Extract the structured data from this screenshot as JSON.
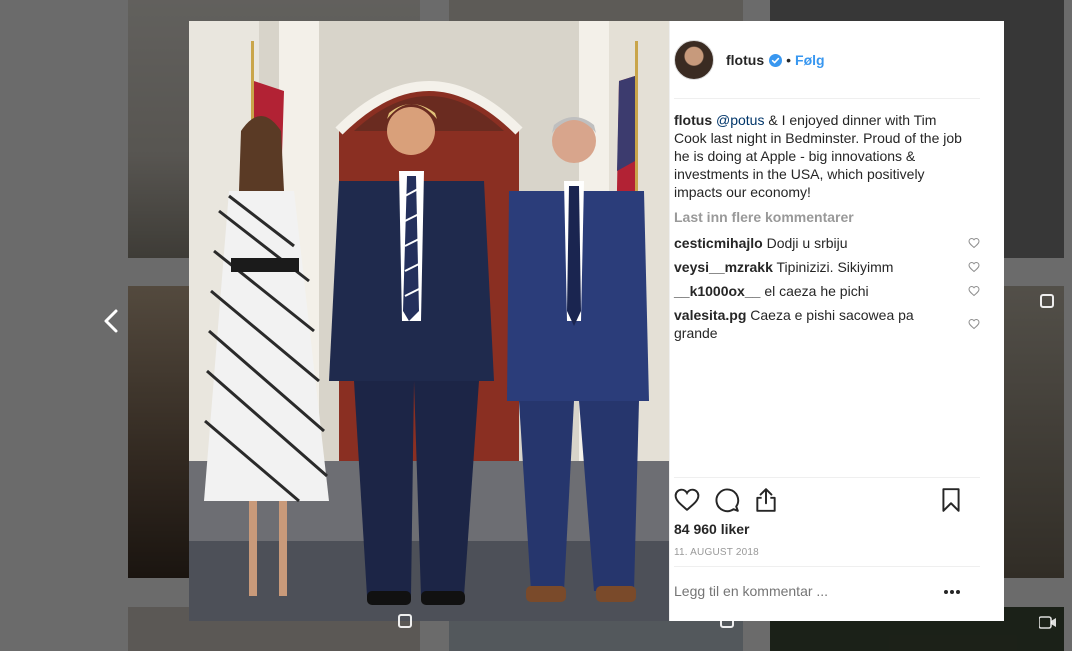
{
  "header": {
    "username": "flotus",
    "separator": "•",
    "follow_label": "Følg"
  },
  "caption": {
    "username": "flotus",
    "mention": "@potus",
    "text": " & I enjoyed dinner with Tim Cook last night in Bedminster. Proud of the job he is doing at Apple - big innovations & investments in the USA, which positively impacts our economy!"
  },
  "load_more_label": "Last inn flere kommentarer",
  "comments": [
    {
      "username": "cesticmihajlo",
      "text": "Dodji u srbiju"
    },
    {
      "username": "veysi__mzrakk",
      "text": "Tipinizizi. Sikiyimm"
    },
    {
      "username": "__k1000ox__",
      "text": "el caeza he pichi"
    },
    {
      "username": "valesita.pg",
      "text": "Caeza e pishi sacowea pa grande"
    }
  ],
  "likes_label": "84 960 liker",
  "date_label": "11. AUGUST 2018",
  "comment_placeholder": "Legg til en kommentar ...",
  "more_label": "...",
  "icons": {
    "verified": "verified-badge-icon",
    "like": "heart-icon",
    "comment": "speech-bubble-icon",
    "share": "share-icon",
    "save": "bookmark-icon",
    "prev": "chevron-left-icon"
  },
  "colors": {
    "link": "#3897f0",
    "mention": "#003569",
    "text": "#262626",
    "muted": "#999999"
  }
}
